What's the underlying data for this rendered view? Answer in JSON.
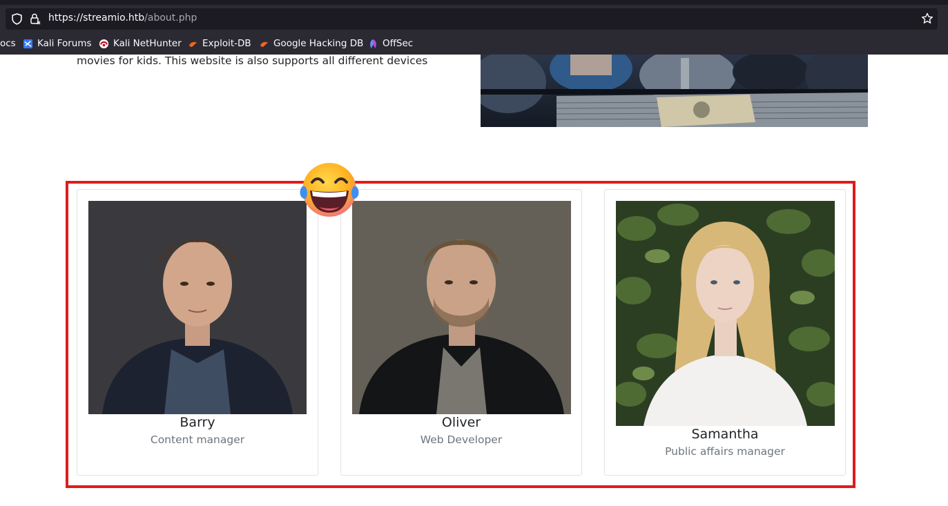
{
  "browser": {
    "url_host": "https://streamio.htb",
    "url_path": "/about.php",
    "bookmarks": [
      {
        "label": "ocs",
        "icon": "docs-icon"
      },
      {
        "label": "Kali Forums",
        "icon": "kali-forums-icon"
      },
      {
        "label": "Kali NetHunter",
        "icon": "kali-nethunter-icon"
      },
      {
        "label": "Exploit-DB",
        "icon": "exploit-db-icon"
      },
      {
        "label": "Google Hacking DB",
        "icon": "google-hacking-db-icon"
      },
      {
        "label": "OffSec",
        "icon": "offsec-icon"
      }
    ]
  },
  "about": {
    "intro_text": "movies for kids. This website is also supports all different devices"
  },
  "team": [
    {
      "name": "Barry",
      "role": "Content manager"
    },
    {
      "name": "Oliver",
      "role": "Web Developer"
    },
    {
      "name": "Samantha",
      "role": "Public affairs manager"
    }
  ],
  "colors": {
    "highlight_border": "#e01b1b",
    "chrome_bg": "#2b2a33",
    "role_text": "#6c757d"
  }
}
